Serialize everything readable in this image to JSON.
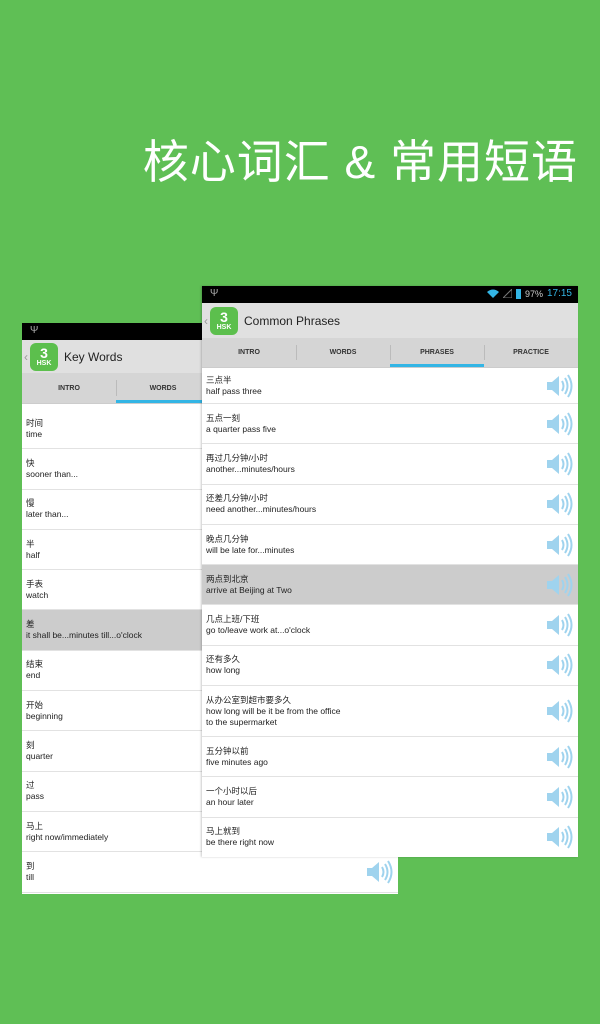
{
  "headline": "核心词汇 & 常用短语",
  "colors": {
    "background": "#5fbf55",
    "accent": "#33b5e5",
    "highlight_row": "#cccccc"
  },
  "left": {
    "title": "Key Words",
    "tabs": [
      "INTRO",
      "WORDS"
    ],
    "active_tab": "WORDS",
    "items": [
      {
        "zh": "时间",
        "en": "time"
      },
      {
        "zh": "快",
        "en": "sooner than..."
      },
      {
        "zh": "慢",
        "en": "later than..."
      },
      {
        "zh": "半",
        "en": "half"
      },
      {
        "zh": "手表",
        "en": "watch"
      },
      {
        "zh": "差",
        "en": "it shall be...minutes till...o'clock",
        "highlighted": true
      },
      {
        "zh": "结束",
        "en": "end"
      },
      {
        "zh": "开始",
        "en": "beginning"
      },
      {
        "zh": "刻",
        "en": "quarter"
      },
      {
        "zh": "过",
        "en": "pass"
      },
      {
        "zh": "马上",
        "en": "right now/immediately"
      },
      {
        "zh": "到",
        "en": "till"
      }
    ]
  },
  "right": {
    "status": {
      "battery": "97%",
      "time": "17:15"
    },
    "title": "Common Phrases",
    "tabs": [
      "INTRO",
      "WORDS",
      "PHRASES",
      "PRACTICE"
    ],
    "active_tab": "PHRASES",
    "items": [
      {
        "zh": "三点半",
        "en": "half pass three"
      },
      {
        "zh": "五点一刻",
        "en": "a quarter pass five"
      },
      {
        "zh": "再过几分钟/小时",
        "en": "another...minutes/hours"
      },
      {
        "zh": "还差几分钟/小时",
        "en": "need another...minutes/hours"
      },
      {
        "zh": "晚点几分钟",
        "en": "will be late for...minutes"
      },
      {
        "zh": "两点到北京",
        "en": "arrive at Beijing at Two",
        "highlighted": true
      },
      {
        "zh": "几点上班/下班",
        "en": "go to/leave work at...o'clock"
      },
      {
        "zh": "还有多久",
        "en": "how long"
      },
      {
        "zh": "从办公室到超市要多久",
        "en": "how long will be it be from the office",
        "en2": "to the supermarket"
      },
      {
        "zh": "五分钟以前",
        "en": "five minutes ago"
      },
      {
        "zh": "一个小时以后",
        "en": "an hour later"
      },
      {
        "zh": "马上就到",
        "en": "be there right now"
      }
    ]
  },
  "icons": {
    "speaker": "speaker-icon",
    "usb": "usb-icon",
    "wifi": "wifi-icon",
    "signal": "signal-icon",
    "battery": "battery-icon",
    "back": "chevron-left-icon"
  }
}
